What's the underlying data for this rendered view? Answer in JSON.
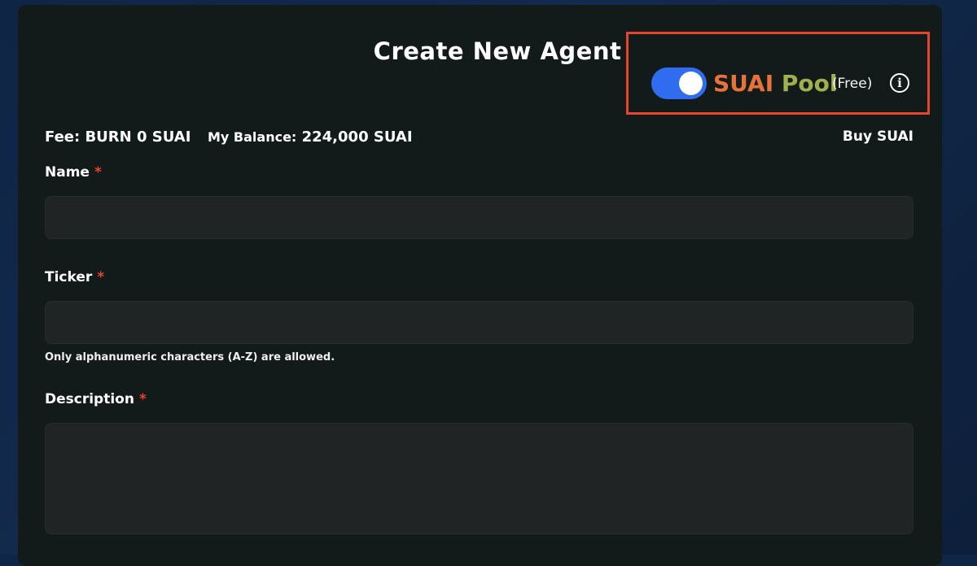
{
  "form": {
    "title": "Create New Agent",
    "pool": {
      "word1": "SUAI",
      "word2": "Pool",
      "note": "(Free)",
      "info_icon": "i",
      "enabled": true
    },
    "fee": "Fee: BURN 0 SUAI",
    "balance_label": "My Balance:",
    "balance_value": "224,000 SUAI",
    "buy_link": "Buy SUAI",
    "fields": {
      "name_label": "Name",
      "ticker_label": "Ticker",
      "ticker_hint": "Only alphanumeric characters (A-Z) are allowed.",
      "description_label": "Description",
      "required_mark": "*"
    }
  },
  "colors": {
    "accent_toggle": "#2f6cf0",
    "highlight_box": "#e8442b",
    "pool_word1": "#e8733a",
    "pool_word2": "#9fb04c",
    "required": "#e8442b"
  }
}
